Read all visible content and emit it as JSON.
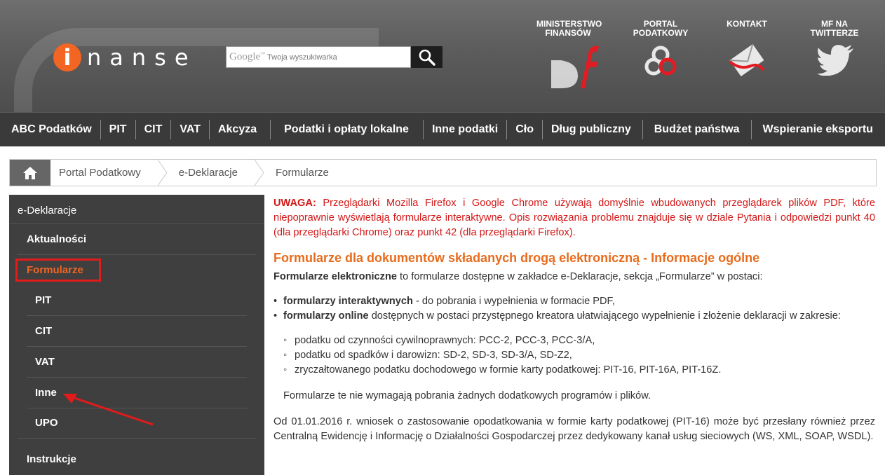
{
  "header": {
    "logo_letter": "i",
    "logo_text": "nanse",
    "search_google": "Google",
    "search_tm": "™",
    "search_placeholder": "Twoja wyszukiwarka",
    "links": [
      {
        "label": "MINISTERSTWO FINANSÓW",
        "icon": "mf-icon"
      },
      {
        "label": "PORTAL PODATKOWY",
        "icon": "portal-icon"
      },
      {
        "label": "KONTAKT",
        "icon": "envelope-icon"
      },
      {
        "label": "MF NA TWITTERZE",
        "icon": "twitter-icon"
      }
    ]
  },
  "nav": [
    "ABC Podatków",
    "PIT",
    "CIT",
    "VAT",
    "Akcyza",
    "Podatki i opłaty lokalne",
    "Inne podatki",
    "Cło",
    "Dług publiczny",
    "Budżet państwa",
    "Wspieranie eksportu"
  ],
  "breadcrumb": [
    "Portal Podatkowy",
    "e-Deklaracje",
    "Formularze"
  ],
  "sidebar": {
    "title": "e-Deklaracje",
    "items": [
      "Aktualności",
      "Formularze",
      "PIT",
      "CIT",
      "VAT",
      "Inne",
      "UPO",
      "Instrukcje"
    ]
  },
  "content": {
    "warn_label": "UWAGA:",
    "warn_text": " Przeglądarki Mozilla Firefox i Google Chrome używają domyślnie wbudowanych przeglądarek plików PDF, które niepoprawnie wyświetlają formularze interaktywne. Opis rozwiązania problemu znajduje się w dziale Pytania i odpowiedzi punkt 40 (dla przeglądarki Chrome) oraz punkt 42 (dla przeglądarki Firefox).",
    "heading": "Formularze dla dokumentów składanych drogą elektroniczną - Informacje ogólne",
    "intro_bold": "Formularze elektroniczne",
    "intro_text": " to formularze dostępne w zakładce e-Deklaracje, sekcja „Formularze” w postaci:",
    "li1_bold": "formularzy interaktywnych",
    "li1_text": " - do pobrania i wypełnienia w formacie PDF,",
    "li2_bold": "formularzy online",
    "li2_text": " dostępnych w postaci przystępnego kreatora ułatwiającego wypełnienie i złożenie deklaracji w zakresie:",
    "sub": [
      "podatku od czynności cywilnoprawnych: PCC-2, PCC-3, PCC-3/A,",
      "podatku od spadków i darowizn: SD-2, SD-3, SD-3/A, SD-Z2,",
      "zryczałtowanego podatku dochodowego w formie karty podatkowej: PIT-16, PIT-16A, PIT-16Z."
    ],
    "note": "Formularze te nie wymagają pobrania żadnych dodatkowych programów i plików.",
    "par": "Od 01.01.2016 r. wniosek o zastosowanie opodatkowania w formie karty podatkowej (PIT-16) może być przesłany również przez Centralną Ewidencję i Informację o Działalności Gospodarczej przez dedykowany kanał usług sieciowych (WS, XML, SOAP, WSDL)."
  },
  "colors": {
    "accent": "#f26522",
    "warn": "#d31616",
    "heading": "#e86b1c",
    "sidebar": "#3f3f3f",
    "nav": "#3a3a3a"
  }
}
